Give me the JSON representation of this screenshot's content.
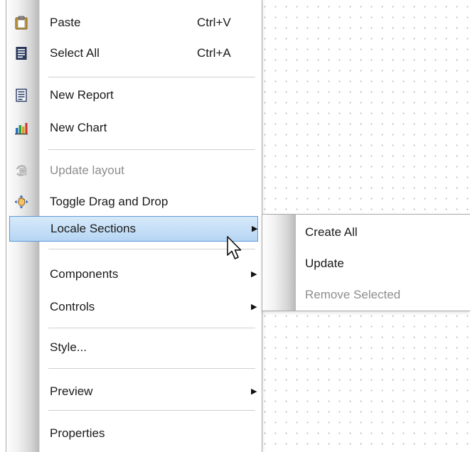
{
  "menu": {
    "items": [
      {
        "label": "Paste",
        "shortcut": "Ctrl+V",
        "icon": "clipboard-paste-icon"
      },
      {
        "label": "Select All",
        "shortcut": "Ctrl+A",
        "icon": "select-all-document-icon"
      },
      {
        "label": "New Report",
        "icon": "new-report-icon"
      },
      {
        "label": "New Chart",
        "icon": "bar-chart-icon"
      },
      {
        "label": "Update layout",
        "icon": "update-layout-icon",
        "disabled": true
      },
      {
        "label": "Toggle Drag and Drop",
        "icon": "drag-hand-icon"
      },
      {
        "label": "Locale Sections",
        "has_submenu": true,
        "highlighted": true
      },
      {
        "label": "Components",
        "has_submenu": true
      },
      {
        "label": "Controls",
        "has_submenu": true
      },
      {
        "label": "Style..."
      },
      {
        "label": "Preview",
        "has_submenu": true
      },
      {
        "label": "Properties"
      }
    ]
  },
  "submenu": {
    "items": [
      {
        "label": "Create All"
      },
      {
        "label": "Update"
      },
      {
        "label": "Remove Selected",
        "disabled": true
      }
    ]
  },
  "colors": {
    "highlight_fill": "#c7e0f7",
    "highlight_border": "#5a9bd8",
    "disabled_text": "#8d8d8d"
  }
}
